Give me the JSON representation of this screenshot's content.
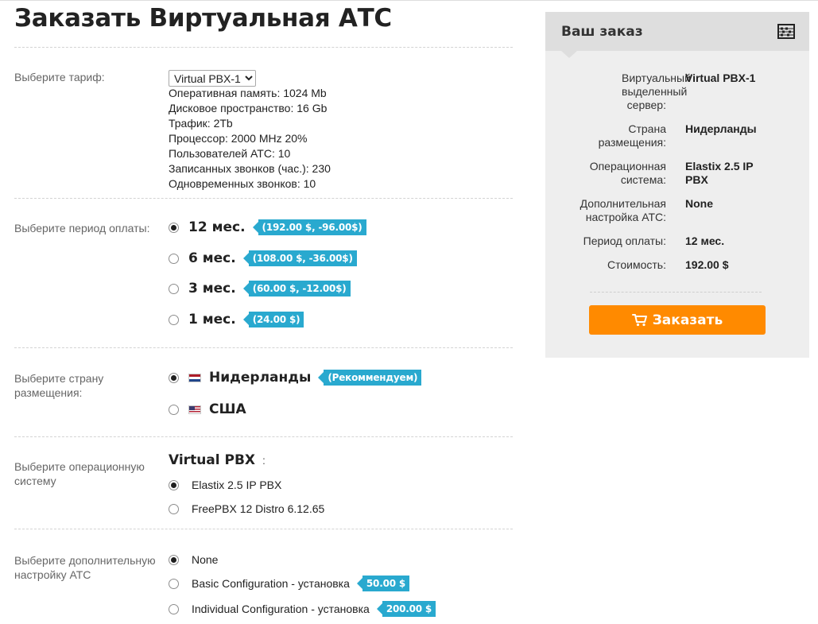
{
  "page": {
    "title": "Заказать Виртуальная АТС"
  },
  "tariff": {
    "label": "Выберите тариф:",
    "selected": "Virtual PBX-1",
    "specs": [
      "Оперативная память: 1024 Mb",
      "Дисковое пространство: 16 Gb",
      "Трафик: 2Tb",
      "Процессор: 2000 MHz 20%",
      "Пользователей АТС: 10",
      "Записанных звонков (час.): 230",
      "Одновременных звонков: 10"
    ]
  },
  "period": {
    "label": "Выберите период оплаты:",
    "options": [
      {
        "label": "12 мес.",
        "price": "(192.00 $, -96.00$)",
        "selected": true
      },
      {
        "label": "6 мес.",
        "price": "(108.00 $, -36.00$)",
        "selected": false
      },
      {
        "label": "3 мес.",
        "price": "(60.00 $, -12.00$)",
        "selected": false
      },
      {
        "label": "1 мес.",
        "price": "(24.00 $)",
        "selected": false
      }
    ]
  },
  "country": {
    "label": "Выберите страну размещения:",
    "options": [
      {
        "label": "Нидерланды",
        "tag": "(Рекоммендуем)",
        "flag": "netherlands-flag",
        "selected": true
      },
      {
        "label": "США",
        "flag": "usa-flag",
        "selected": false
      }
    ]
  },
  "os": {
    "label": "Выберите операционную систему",
    "group_title": "Virtual PBX",
    "group_colon": ":",
    "options": [
      {
        "label": "Elastix 2.5 IP PBX",
        "selected": true
      },
      {
        "label": "FreePBX 12 Distro 6.12.65",
        "selected": false
      }
    ]
  },
  "setup": {
    "label": "Выберите дополнительную настройку АТС",
    "options": [
      {
        "label": "None",
        "selected": true
      },
      {
        "label": "Basic Configuration - установка",
        "price": "50.00 $",
        "selected": false
      },
      {
        "label": "Individual Configuration - установка",
        "price": "200.00 $",
        "selected": false
      }
    ]
  },
  "order": {
    "title": "Ваш заказ",
    "rows": [
      {
        "label": "Виртуальный выделенный сервер:",
        "value": "Virtual PBX-1"
      },
      {
        "label": "Страна размещения:",
        "value": "Нидерланды"
      },
      {
        "label": "Операционная система:",
        "value": "Elastix 2.5 IP PBX"
      },
      {
        "label": "Дополнительная настройка АТС:",
        "value": "None"
      },
      {
        "label": "Период оплаты:",
        "value": "12 мес."
      },
      {
        "label": "Стоимость:",
        "value": "192.00 $"
      }
    ],
    "button_label": "Заказать"
  },
  "colors": {
    "accent": "#29a9cf",
    "button": "#ff8a00",
    "panel": "#eeeeee",
    "panel_header": "#dedede"
  },
  "icons": {
    "panel": "abacus-icon",
    "button": "cart-icon"
  }
}
